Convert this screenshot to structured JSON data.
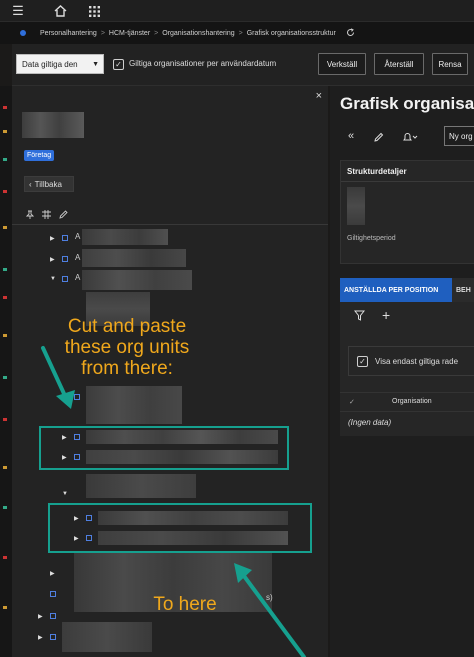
{
  "topbar": {
    "menu_icon": "☰",
    "home_icon": "⌂",
    "apps_icon": "⋮⋮"
  },
  "breadcrumb": [
    "Personalhantering",
    "HCM-tjänster",
    "Organisationshantering",
    "Grafisk organisationsstruktur"
  ],
  "breadcrumb_sep": ">",
  "toolbar": {
    "date_select": "Data giltiga den",
    "checkbox_label": "Giltiga organisationer per användardatum",
    "buttons": [
      "Verkställ",
      "Återställ",
      "Rensa"
    ]
  },
  "left_panel": {
    "badge": "Företag",
    "back_label": "Tillbaka",
    "close_label": "×",
    "tree_glyphs": [
      "A",
      "A",
      "A"
    ]
  },
  "annotations": {
    "cut_note_lines": [
      "Cut and paste",
      "these org units",
      "from there:"
    ],
    "here_note": "To here",
    "stray_char": "s)"
  },
  "right_panel": {
    "title": "Grafisk organisa",
    "new_org_button": "Ny org",
    "card_title": "Strukturdetaljer",
    "validity_label": "Giltighetsperiod",
    "tabs": [
      "ANSTÄLLDA PER POSITION",
      "BEH"
    ],
    "visa_label": "Visa endast giltiga rade",
    "column_org": "Organisation",
    "empty_text": "(Ingen data)"
  },
  "colors": {
    "accent": "#2f6fdb",
    "annotation_text": "#f0a81c",
    "annotation_box": "#16a08f"
  }
}
